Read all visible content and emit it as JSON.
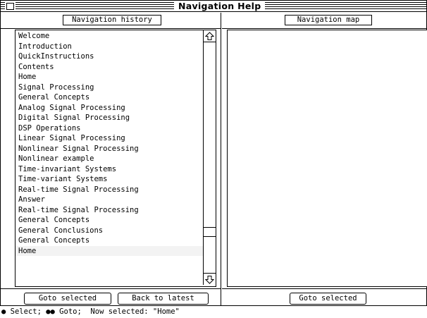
{
  "window": {
    "title": "Navigation Help"
  },
  "history": {
    "header_label": "Navigation history",
    "items": [
      "Welcome",
      "Introduction",
      "QuickInstructions",
      "Contents",
      "Home",
      "Signal Processing",
      "General Concepts",
      "Analog Signal Processing",
      "Digital Signal Processing",
      "DSP Operations",
      "Linear Signal Processing",
      "Nonlinear Signal Processing",
      "Nonlinear example",
      "Time-invariant Systems",
      "Time-variant Systems",
      "Real-time Signal Processing",
      "Answer",
      "Real-time Signal Processing",
      "General Concepts",
      "General Conclusions",
      "General Concepts",
      "Home"
    ],
    "selected_index": 21,
    "goto_label": "Goto selected",
    "back_label": "Back to latest"
  },
  "map": {
    "header_label": "Navigation map",
    "goto_label": "Goto selected"
  },
  "status": {
    "text": "● Select; ●● Goto;  Now selected: \"Home\""
  },
  "icons": {
    "close_box": "close-box-icon",
    "scroll_up": "arrow-up-icon",
    "scroll_down": "arrow-down-icon"
  }
}
